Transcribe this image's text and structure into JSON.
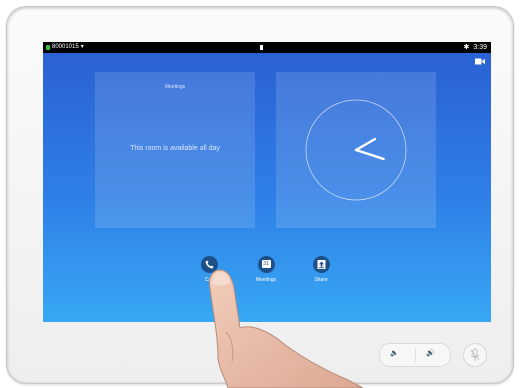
{
  "status_bar": {
    "number": "80001015",
    "time": "3:39"
  },
  "meetings_panel": {
    "title": "Meetings",
    "message": "This room is available all day"
  },
  "clock": {
    "hour_angle_deg": 60,
    "minute_angle_deg": 108
  },
  "actions": [
    {
      "label": "Call",
      "icon": "phone-icon"
    },
    {
      "label": "Meetings",
      "icon": "calendar-icon",
      "calendar_day": "31"
    },
    {
      "label": "Share",
      "icon": "share-upload-icon"
    }
  ],
  "colors": {
    "screen_top": "#2a5fd2",
    "screen_bottom": "#37a8f4",
    "action_circle": "#1d4f88",
    "status_green": "#3ac23a"
  }
}
